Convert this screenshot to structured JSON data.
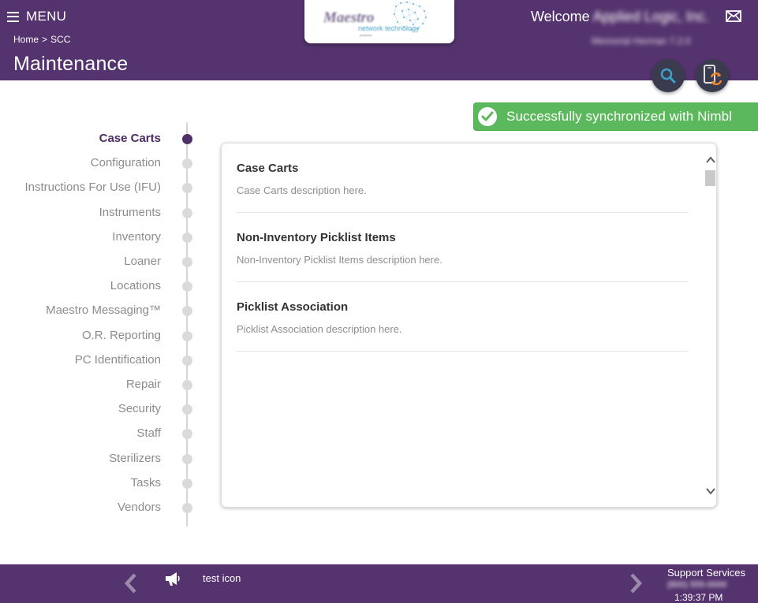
{
  "colors": {
    "brand_purple": "#55336e",
    "active_nav": "#4a2d63",
    "success_green": "#5cb85c",
    "sync_orange": "#f28a2c",
    "search_blue": "#3aa0c8"
  },
  "header": {
    "menu_label": "MENU",
    "breadcrumb": {
      "home": "Home",
      "separator": ">",
      "current": "SCC"
    },
    "page_title": "Maintenance",
    "logo": {
      "word": "Maestro",
      "sub": "network technology",
      "tiny": "powered"
    },
    "welcome_prefix": "Welcome",
    "account_name": "Applied Logic, Inc.",
    "account_sub": "Memorial Herman 7.2.0",
    "icons": {
      "mail": "envelope-icon",
      "search": "search-icon",
      "sync": "mobile-sync-icon"
    }
  },
  "toast": {
    "message": "Successfully synchronized with Nimbl",
    "icon": "check-circle-icon"
  },
  "nav": {
    "active_index": 0,
    "items": [
      {
        "label": "Case Carts"
      },
      {
        "label": "Configuration"
      },
      {
        "label": "Instructions For Use (IFU)"
      },
      {
        "label": "Instruments"
      },
      {
        "label": "Inventory"
      },
      {
        "label": "Loaner"
      },
      {
        "label": "Locations"
      },
      {
        "label": "Maestro Messaging™"
      },
      {
        "label": "O.R. Reporting"
      },
      {
        "label": "PC Identification"
      },
      {
        "label": "Repair"
      },
      {
        "label": "Security"
      },
      {
        "label": "Staff"
      },
      {
        "label": "Sterilizers"
      },
      {
        "label": "Tasks"
      },
      {
        "label": "Vendors"
      }
    ]
  },
  "content": {
    "entries": [
      {
        "title": "Case Carts",
        "description": "Case Carts description here."
      },
      {
        "title": "Non-Inventory Picklist Items",
        "description": "Non-Inventory Picklist Items description here."
      },
      {
        "title": "Picklist Association",
        "description": "Picklist Association description here."
      }
    ]
  },
  "footer": {
    "message": "test icon",
    "support_label": "Support Services",
    "support_phone": "(800) 555-0000",
    "time": "1:39:37 PM",
    "icons": {
      "prev": "chevron-left-icon",
      "next": "chevron-right-icon",
      "announcement": "megaphone-icon"
    }
  }
}
